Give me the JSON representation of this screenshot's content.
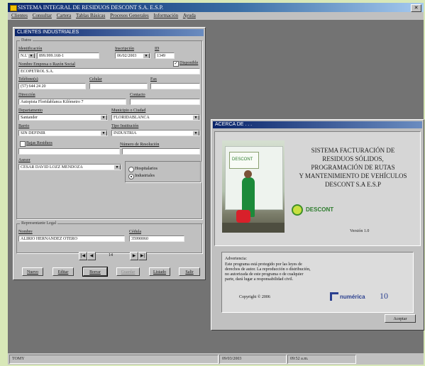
{
  "app": {
    "title": "SISTEMA INTEGRAL DE RESIDUOS DESCONT S.A. E.S.P.",
    "close_label": "✕",
    "menu": [
      "Clientes",
      "Consultar",
      "Cartera",
      "Tablas Básicas",
      "Procesos Generales",
      "Información",
      "Ayuda"
    ]
  },
  "client_form": {
    "title": "CLIENTES INDUSTRIALES",
    "group_datos": "Datos",
    "identificacion_label": "Identificación",
    "identificacion_tipo": "N.I.T.",
    "identificacion_valor": "899.999.168-1",
    "inscripcion_label": "Inscripción",
    "inscripcion_valor": "06/02/2003",
    "id_label": "ID",
    "id_valor": "1349",
    "nombre_label": "Nombre Empresa o Razón Social",
    "nombre_valor": "ECOPETROL S.A.",
    "disponible_label": "Disponible",
    "disponible_checked": true,
    "telefono_label": "Teléfono(s)",
    "telefono_valor": "(57) 644 24 20",
    "celular_label": "Celular",
    "celular_valor": "",
    "fax_label": "Fax",
    "fax_valor": "",
    "direccion_label": "Dirección",
    "direccion_valor": "Autopista Floridablanca Kilómetro 7",
    "contacto_label": "Contacto",
    "contacto_valor": "",
    "departamento_label": "Departamento",
    "departamento_valor": "Santander",
    "municipio_label": "Municipio o Ciudad",
    "municipio_valor": "FLORIDABLANCA",
    "barrio_label": "Barrio",
    "barrio_valor": "SIN DEFINIR",
    "tipo_label": "Tipo Institución",
    "tipo_valor": "INDUSTRIA",
    "bajas_label": "Bajas Residuos",
    "numero_resolucion_label": "Número de Resolución",
    "asesor_label": "Asesor",
    "asesor_valor": "CESAR DAVID LOZZ MENDOZA",
    "hospitalarios_label": "Hospitalarios",
    "industriales_label": "Industriales",
    "group_representante": "Representante Legal",
    "rep_nombre_label": "Nombre",
    "rep_nombre_valor": "ALIRIO HERNANDEZ OTERO",
    "rep_cedula_label": "Cédula",
    "rep_cedula_valor": "35990060",
    "nav_first": "|◀",
    "nav_prev": "◀",
    "nav_next": "▶",
    "nav_last": "▶|",
    "record_number": "14",
    "buttons": [
      "Nuevo",
      "Editar",
      "Borrar",
      "Guardar",
      "Listado",
      "Salir"
    ]
  },
  "about": {
    "title": "ACERCA DE . . .",
    "logo_text": "DESCONT",
    "heading": [
      "SISTEMA FACTURACIÓN DE",
      "RESIDUOS SÓLIDOS,",
      "PROGRAMACIÓN DE RUTAS",
      "Y MANTENIMIENTO DE VEHÍCULOS",
      "DESCONT S.A E.S.P"
    ],
    "version": "Versión 1.0",
    "warning_title": "Advertencia:",
    "warning_lines": [
      "Este programa está protegido por las leyes de",
      "derechos de autor. La reproducción o distribución,",
      "no autorizada de este programa o de cualquier",
      "parte, dará lugar a responsabilidad civil."
    ],
    "copyright": "Copyright © 2006",
    "brand": "numérica",
    "brand_suffix": "10",
    "accept_label": "Aceptar"
  },
  "status": {
    "user": "TOMY",
    "date": "09/03/2003",
    "time": "09:52 a.m."
  }
}
